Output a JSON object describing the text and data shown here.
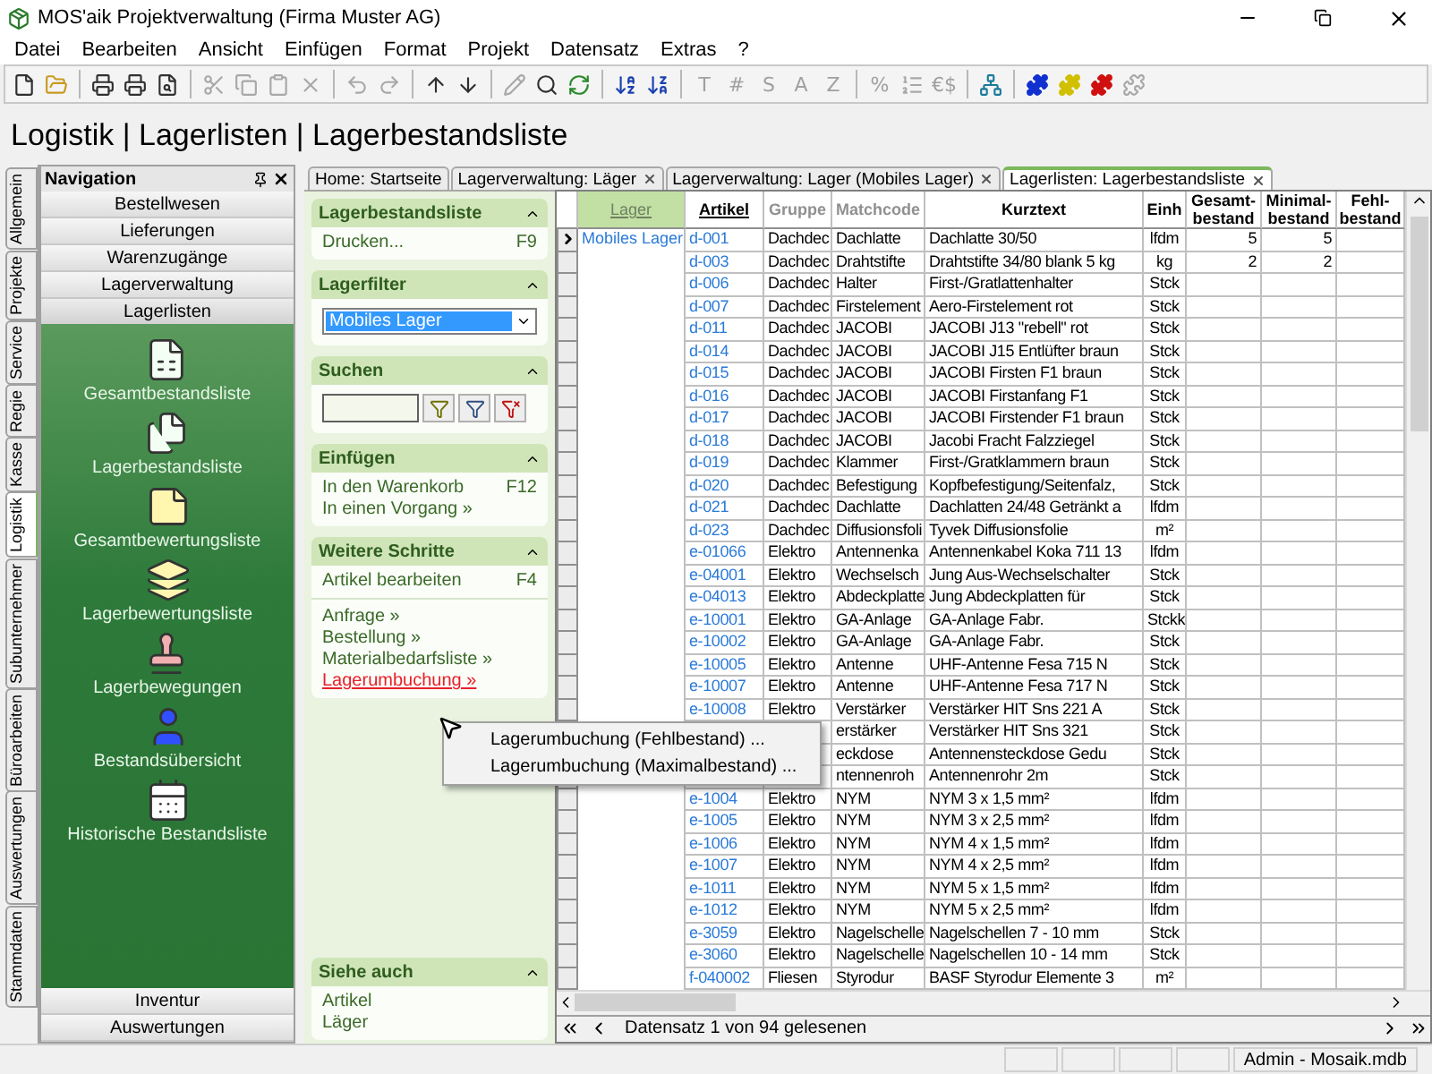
{
  "window": {
    "title": "MOS'aik Projektverwaltung (Firma Muster AG)"
  },
  "menu": [
    "Datei",
    "Bearbeiten",
    "Ansicht",
    "Einfügen",
    "Format",
    "Projekt",
    "Datensatz",
    "Extras",
    "?"
  ],
  "toolbar": [
    {
      "kind": "icon",
      "disabled": false
    },
    {
      "kind": "icon",
      "disabled": false
    },
    {
      "kind": "sep"
    },
    {
      "kind": "icon",
      "disabled": false
    },
    {
      "kind": "icon",
      "disabled": false
    },
    {
      "kind": "icon",
      "disabled": false
    },
    {
      "kind": "sep"
    },
    {
      "kind": "icon",
      "disabled": true
    },
    {
      "kind": "icon",
      "disabled": true
    },
    {
      "kind": "icon",
      "disabled": true
    },
    {
      "kind": "icon",
      "disabled": true
    },
    {
      "kind": "sep"
    },
    {
      "kind": "icon",
      "disabled": true
    },
    {
      "kind": "icon",
      "disabled": true
    },
    {
      "kind": "sep"
    },
    {
      "kind": "icon",
      "disabled": false
    },
    {
      "kind": "icon",
      "disabled": false
    },
    {
      "kind": "sep"
    },
    {
      "kind": "icon",
      "disabled": true
    },
    {
      "kind": "icon",
      "disabled": false
    },
    {
      "kind": "icon",
      "disabled": false
    },
    {
      "kind": "sep"
    },
    {
      "kind": "icon",
      "disabled": false
    },
    {
      "kind": "icon",
      "disabled": false
    },
    {
      "kind": "sep"
    },
    {
      "kind": "glyph",
      "label": "T",
      "disabled": true
    },
    {
      "kind": "glyph",
      "label": "#",
      "disabled": true
    },
    {
      "kind": "glyph",
      "label": "S",
      "disabled": true
    },
    {
      "kind": "glyph",
      "label": "A",
      "disabled": true
    },
    {
      "kind": "glyph",
      "label": "Z",
      "disabled": true
    },
    {
      "kind": "sep"
    },
    {
      "kind": "glyph",
      "label": "%",
      "disabled": true
    },
    {
      "kind": "icon",
      "disabled": true
    },
    {
      "kind": "glyph",
      "label": "€$",
      "disabled": true
    },
    {
      "kind": "sep"
    },
    {
      "kind": "icon",
      "disabled": false
    },
    {
      "kind": "sep"
    },
    {
      "kind": "icon",
      "disabled": false
    },
    {
      "kind": "icon",
      "disabled": false
    },
    {
      "kind": "icon",
      "disabled": false
    },
    {
      "kind": "icon",
      "disabled": true
    }
  ],
  "breadcrumb": "Logistik | Lagerlisten | Lagerbestandsliste",
  "side_tabs": [
    {
      "label": "Allgemein",
      "selected": false
    },
    {
      "label": "Projekte",
      "selected": false
    },
    {
      "label": "Service",
      "selected": false
    },
    {
      "label": "Regie",
      "selected": false
    },
    {
      "label": "Kasse",
      "selected": false
    },
    {
      "label": "Logistik",
      "selected": true
    },
    {
      "label": "Subunternehmer",
      "selected": false
    },
    {
      "label": "Büroarbeiten",
      "selected": false
    },
    {
      "label": "Auswertungen",
      "selected": false
    },
    {
      "label": "Stammdaten",
      "selected": false
    }
  ],
  "navigation": {
    "title": "Navigation",
    "groups_top": [
      {
        "label": "Bestellwesen",
        "expanded": false
      },
      {
        "label": "Lieferungen",
        "expanded": false
      },
      {
        "label": "Warenzugänge",
        "expanded": false
      },
      {
        "label": "Lagerverwaltung",
        "expanded": false
      },
      {
        "label": "Lagerlisten",
        "expanded": true
      }
    ],
    "items": [
      "Gesamtbestandsliste",
      "Lagerbestandsliste",
      "Gesamtbewertungsliste",
      "Lagerbewertungsliste",
      "Lagerbewegungen",
      "Bestandsübersicht",
      "Historische Bestandsliste"
    ],
    "groups_bottom": [
      {
        "label": "Inventur",
        "expanded": false
      },
      {
        "label": "Auswertungen",
        "expanded": false
      }
    ]
  },
  "doc_tabs": [
    {
      "label": "Home: Startseite",
      "closable": false,
      "selected": false
    },
    {
      "label": "Lagerverwaltung: Läger",
      "closable": true,
      "selected": false
    },
    {
      "label": "Lagerverwaltung: Lager (Mobiles Lager)",
      "closable": true,
      "selected": false
    },
    {
      "label": "Lagerlisten: Lagerbestandsliste",
      "closable": true,
      "selected": true
    }
  ],
  "task_pane": [
    {
      "kind": "links",
      "title": "Lagerbestandsliste",
      "expanded": true,
      "links": [
        {
          "label": "Drucken...",
          "shortcut": "F9",
          "hovered": false
        }
      ]
    },
    {
      "kind": "select",
      "title": "Lagerfilter",
      "expanded": true,
      "value": "Mobiles Lager"
    },
    {
      "kind": "search",
      "title": "Suchen",
      "expanded": true
    },
    {
      "kind": "links",
      "title": "Einfügen",
      "expanded": true,
      "links": [
        {
          "label": "In den Warenkorb",
          "shortcut": "F12",
          "hovered": false
        },
        {
          "label": "In einen Vorgang »",
          "hovered": false
        }
      ]
    },
    {
      "kind": "links",
      "title": "Weitere Schritte",
      "expanded": true,
      "links": [
        {
          "label": "Artikel bearbeiten",
          "shortcut": "F4",
          "hovered": false
        }
      ],
      "more_links": [
        {
          "label": "Anfrage »",
          "hovered": false
        },
        {
          "label": "Bestellung »",
          "hovered": false
        },
        {
          "label": "Materialbedarfsliste »",
          "hovered": false
        },
        {
          "label": "Lagerumbuchung »",
          "hovered": true
        }
      ]
    },
    {
      "kind": "spacer"
    },
    {
      "kind": "links",
      "title": "Siehe auch",
      "expanded": true,
      "links": [
        {
          "label": "Artikel",
          "hovered": false
        },
        {
          "label": "Läger",
          "hovered": false
        }
      ]
    }
  ],
  "table": {
    "columns": [
      {
        "label": "Lager",
        "kind": "group"
      },
      {
        "label": "Artikel",
        "kind": "sorted"
      },
      {
        "label": "Gruppe",
        "kind": "dim"
      },
      {
        "label": "Matchcode",
        "kind": "dim"
      },
      {
        "label": "Kurztext",
        "kind": "plain"
      },
      {
        "label": "Einh",
        "kind": "plain"
      },
      {
        "label": "Gesamt-\nbestand",
        "kind": "plain"
      },
      {
        "label": "Minimal-\nbestand",
        "kind": "plain"
      },
      {
        "label": "Fehl-\nbestand",
        "kind": "plain"
      }
    ],
    "rows": [
      {
        "current": true,
        "lager": "Mobiles Lager",
        "artikel": "d-001",
        "gruppe": "Dachdec",
        "matchcode": "Dachlatte",
        "kurztext": "Dachlatte 30/50",
        "einh": "lfdm",
        "gesamt": "5",
        "minimal": "5"
      },
      {
        "current": false,
        "artikel": "d-003",
        "gruppe": "Dachdec",
        "matchcode": "Drahtstifte",
        "kurztext": "Drahtstifte 34/80 blank 5 kg",
        "einh": "kg",
        "gesamt": "2",
        "minimal": "2"
      },
      {
        "current": false,
        "artikel": "d-006",
        "gruppe": "Dachdec",
        "matchcode": "Halter",
        "kurztext": "First-/Gratlattenhalter",
        "einh": "Stck"
      },
      {
        "current": false,
        "artikel": "d-007",
        "gruppe": "Dachdec",
        "matchcode": "Firstelement",
        "kurztext": "Aero-Firstelement rot",
        "einh": "Stck"
      },
      {
        "current": false,
        "artikel": "d-011",
        "gruppe": "Dachdec",
        "matchcode": "JACOBI",
        "kurztext": "JACOBI J13 \"rebell\" rot",
        "einh": "Stck"
      },
      {
        "current": false,
        "artikel": "d-014",
        "gruppe": "Dachdec",
        "matchcode": "JACOBI",
        "kurztext": "JACOBI J15 Entlüfter braun",
        "einh": "Stck"
      },
      {
        "current": false,
        "artikel": "d-015",
        "gruppe": "Dachdec",
        "matchcode": "JACOBI",
        "kurztext": "JACOBI Firsten F1 braun",
        "einh": "Stck"
      },
      {
        "current": false,
        "artikel": "d-016",
        "gruppe": "Dachdec",
        "matchcode": "JACOBI",
        "kurztext": "JACOBI Firstanfang F1",
        "einh": "Stck"
      },
      {
        "current": false,
        "artikel": "d-017",
        "gruppe": "Dachdec",
        "matchcode": "JACOBI",
        "kurztext": "JACOBI Firstender F1 braun",
        "einh": "Stck"
      },
      {
        "current": false,
        "artikel": "d-018",
        "gruppe": "Dachdec",
        "matchcode": "JACOBI",
        "kurztext": "Jacobi Fracht Falzziegel",
        "einh": "Stck"
      },
      {
        "current": false,
        "artikel": "d-019",
        "gruppe": "Dachdec",
        "matchcode": "Klammer",
        "kurztext": "First-/Gratklammern braun",
        "einh": "Stck"
      },
      {
        "current": false,
        "artikel": "d-020",
        "gruppe": "Dachdec",
        "matchcode": "Befestigung",
        "kurztext": "Kopfbefestigung/Seitenfalz,",
        "einh": "Stck"
      },
      {
        "current": false,
        "artikel": "d-021",
        "gruppe": "Dachdec",
        "matchcode": "Dachlatte",
        "kurztext": "Dachlatten 24/48 Getränkt a",
        "einh": "lfdm"
      },
      {
        "current": false,
        "artikel": "d-023",
        "gruppe": "Dachdec",
        "matchcode": "Diffusionsfoli",
        "kurztext": "Tyvek Diffusionsfolie",
        "einh": "m²"
      },
      {
        "current": false,
        "artikel": "e-01066",
        "gruppe": "Elektro",
        "matchcode": "Antennenka",
        "kurztext": "Antennenkabel Koka 711 13",
        "einh": "lfdm"
      },
      {
        "current": false,
        "artikel": "e-04001",
        "gruppe": "Elektro",
        "matchcode": "Wechselsch",
        "kurztext": "Jung Aus-Wechselschalter",
        "einh": "Stck"
      },
      {
        "current": false,
        "artikel": "e-04013",
        "gruppe": "Elektro",
        "matchcode": "Abdeckplatte",
        "kurztext": "Jung Abdeckplatten für",
        "einh": "Stck"
      },
      {
        "current": false,
        "artikel": "e-10001",
        "gruppe": "Elektro",
        "matchcode": "GA-Anlage",
        "kurztext": "GA-Anlage Fabr.",
        "einh": "Stckk"
      },
      {
        "current": false,
        "artikel": "e-10002",
        "gruppe": "Elektro",
        "matchcode": "GA-Anlage",
        "kurztext": "GA-Anlage Fabr.",
        "einh": "Stck"
      },
      {
        "current": false,
        "artikel": "e-10005",
        "gruppe": "Elektro",
        "matchcode": "Antenne",
        "kurztext": "UHF-Antenne Fesa 715 N",
        "einh": "Stck"
      },
      {
        "current": false,
        "artikel": "e-10007",
        "gruppe": "Elektro",
        "matchcode": "Antenne",
        "kurztext": "UHF-Antenne Fesa 717 N",
        "einh": "Stck"
      },
      {
        "current": false,
        "artikel": "e-10008",
        "gruppe": "Elektro",
        "matchcode": "Verstärker",
        "kurztext": "Verstärker HIT Sns 221 A",
        "einh": "Stck"
      },
      {
        "matchcode": "erstärker",
        "kurztext": "Verstärker HIT Sns 321",
        "einh": "Stck"
      },
      {
        "matchcode": "eckdose",
        "kurztext": "Antennensteckdose Gedu",
        "einh": "Stck"
      },
      {
        "matchcode": "ntennenroh",
        "kurztext": "Antennenrohr 2m",
        "einh": "Stck"
      },
      {
        "current": false,
        "artikel": "e-1004",
        "gruppe": "Elektro",
        "matchcode": "NYM",
        "kurztext": "NYM 3 x 1,5 mm²",
        "einh": "lfdm"
      },
      {
        "current": false,
        "artikel": "e-1005",
        "gruppe": "Elektro",
        "matchcode": "NYM",
        "kurztext": "NYM 3 x 2,5 mm²",
        "einh": "lfdm"
      },
      {
        "current": false,
        "artikel": "e-1006",
        "gruppe": "Elektro",
        "matchcode": "NYM",
        "kurztext": "NYM 4 x 1,5 mm²",
        "einh": "lfdm"
      },
      {
        "current": false,
        "artikel": "e-1007",
        "gruppe": "Elektro",
        "matchcode": "NYM",
        "kurztext": "NYM 4 x 2,5 mm²",
        "einh": "lfdm"
      },
      {
        "current": false,
        "artikel": "e-1011",
        "gruppe": "Elektro",
        "matchcode": "NYM",
        "kurztext": "NYM 5 x 1,5 mm²",
        "einh": "lfdm"
      },
      {
        "current": false,
        "artikel": "e-1012",
        "gruppe": "Elektro",
        "matchcode": "NYM",
        "kurztext": "NYM 5 x 2,5 mm²",
        "einh": "lfdm"
      },
      {
        "current": false,
        "artikel": "e-3059",
        "gruppe": "Elektro",
        "matchcode": "Nagelschelle",
        "kurztext": "Nagelschellen 7 - 10 mm",
        "einh": "Stck"
      },
      {
        "current": false,
        "artikel": "e-3060",
        "gruppe": "Elektro",
        "matchcode": "Nagelschelle",
        "kurztext": "Nagelschellen 10 - 14 mm",
        "einh": "Stck"
      },
      {
        "current": false,
        "artikel": "f-040002",
        "gruppe": "Fliesen",
        "matchcode": "Styrodur",
        "kurztext": "BASF Styrodur Elemente 3",
        "einh": "m²"
      }
    ],
    "record_status": "Datensatz 1 von 94 gelesenen"
  },
  "context_menu": [
    "Lagerumbuchung (Fehlbestand) ...",
    "Lagerumbuchung (Maximalbestand) ..."
  ],
  "status_bar": {
    "user": "Admin - Mosaik.mdb"
  }
}
